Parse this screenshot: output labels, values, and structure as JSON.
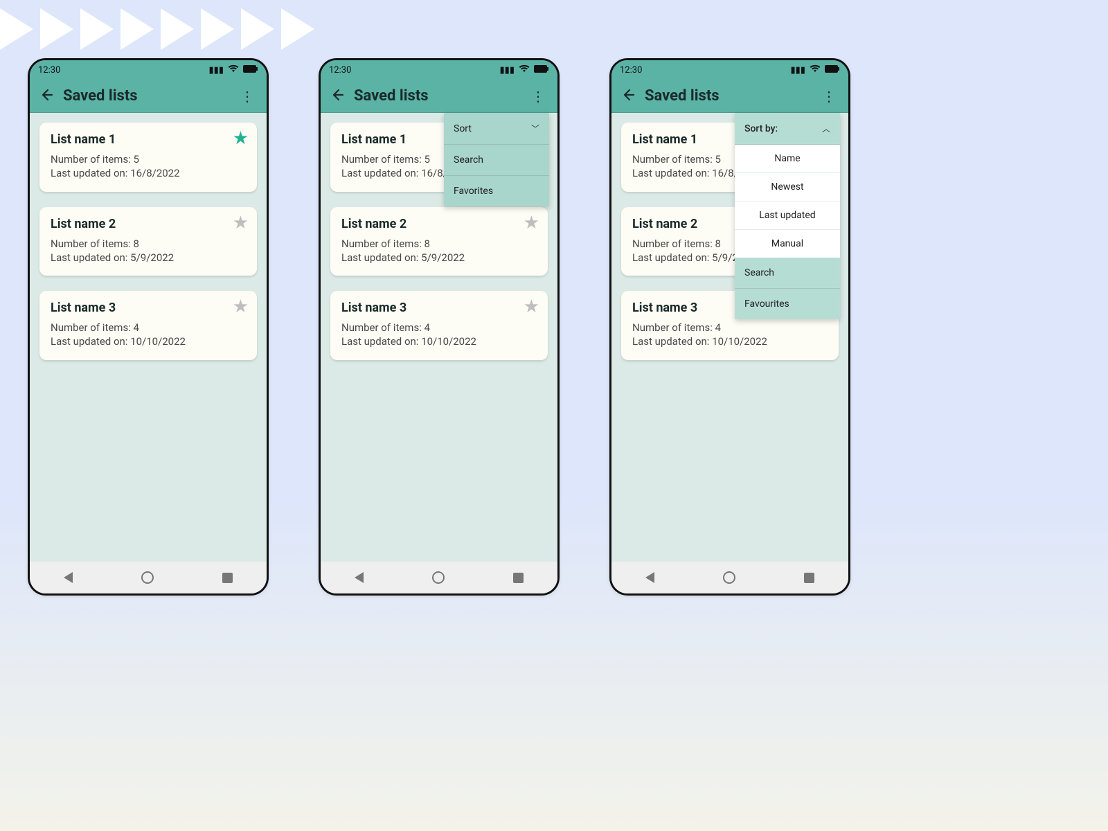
{
  "status": {
    "time": "12:30"
  },
  "header": {
    "title": "Saved lists"
  },
  "lists": [
    {
      "name": "List name 1",
      "items_label": "Number of items: 5",
      "updated_label": "Last updated on: 16/8/2022",
      "fav": true
    },
    {
      "name": "List name 2",
      "items_label": "Number of items: 8",
      "updated_label": "Last updated on: 5/9/2022",
      "fav": false
    },
    {
      "name": "List name 3",
      "items_label": "Number of items: 4",
      "updated_label": "Last updated on: 10/10/2022",
      "fav": false
    }
  ],
  "menu_closed": {
    "sort": "Sort",
    "search": "Search",
    "favorites": "Favorites"
  },
  "menu_open": {
    "sort_by": "Sort by:",
    "options": [
      "Name",
      "Newest",
      "Last updated",
      "Manual"
    ],
    "search": "Search",
    "favourites": "Favourites"
  }
}
